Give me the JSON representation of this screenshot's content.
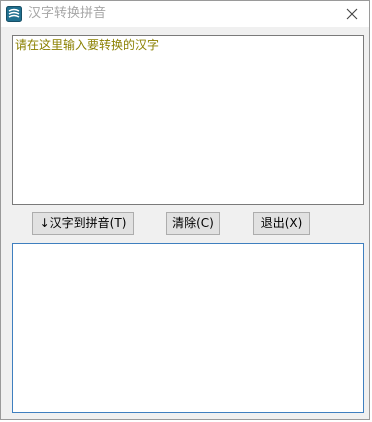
{
  "window": {
    "title": "汉字转换拼音",
    "icon": "app-logo-icon",
    "close_icon": "close-icon",
    "title_color": "#a6a6a6"
  },
  "input": {
    "value": "请在这里输入要转换的汉字",
    "text_color": "#8b8000"
  },
  "buttons": {
    "convert_label": "↓汉字到拼音(T)",
    "clear_label": "清除(C)",
    "exit_label": "退出(X)"
  },
  "output": {
    "value": ""
  }
}
